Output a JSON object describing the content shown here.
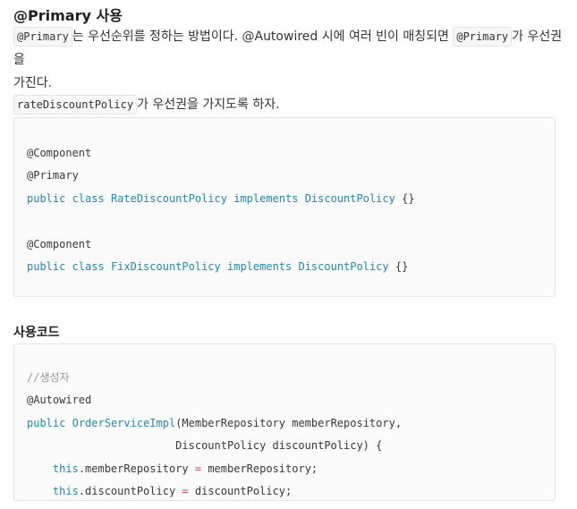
{
  "heading_primary": "@Primary 사용",
  "para1": {
    "code1": "@Primary",
    "text1": "는 우선순위를 정하는 방법이다. @Autowired 시에 여러 빈이 매칭되면",
    "code2": "@Primary",
    "text2": "가 우선권을",
    "text3": "가진다."
  },
  "para2": {
    "code1": "rateDiscountPolicy",
    "text1": "가 우선권을 가지도록 하자."
  },
  "code_block_1": {
    "lines": [
      "@Component",
      "@Primary",
      "public class RateDiscountPolicy implements DiscountPolicy {}",
      "",
      "@Component",
      "public class FixDiscountPolicy implements DiscountPolicy {}"
    ],
    "tokens": {
      "l3_kw": "public class",
      "l3_name": "RateDiscountPolicy",
      "l3_impl": "implements",
      "l3_iface": "DiscountPolicy",
      "l3_tail": "{}",
      "l6_kw": "public class",
      "l6_name": "FixDiscountPolicy",
      "l6_impl": "implements",
      "l6_iface": "DiscountPolicy",
      "l6_tail": "{}"
    }
  },
  "heading_usage": "사용코드",
  "code_block_2": {
    "lines": [
      "//생성자",
      "@Autowired",
      "public OrderServiceImpl(MemberRepository memberRepository,",
      "                       DiscountPolicy discountPolicy) {",
      "    this.memberRepository = memberRepository;",
      "    this.discountPolicy = discountPolicy;"
    ],
    "tokens": {
      "comment": "//생성자",
      "annotation": "@Autowired",
      "l3_kw": "public",
      "l3_name": "OrderServiceImpl",
      "l3_args": "(MemberRepository memberRepository,",
      "l4_args": "                       DiscountPolicy discountPolicy) {",
      "l5_this": "this",
      "l5_field": ".memberRepository ",
      "l5_eq": "=",
      "l5_rhs": " memberRepository;",
      "l6_this": "this",
      "l6_field": ".discountPolicy ",
      "l6_eq": "=",
      "l6_rhs": " discountPolicy;"
    }
  },
  "colors": {
    "keyword": "#1e88b8",
    "comment": "#9a9a9a",
    "operator": "#d5426a",
    "text": "#383838"
  }
}
